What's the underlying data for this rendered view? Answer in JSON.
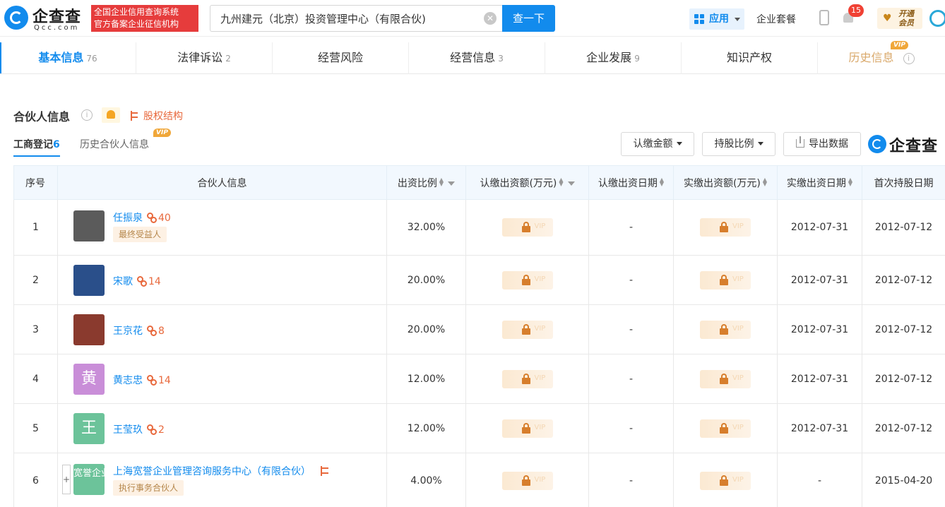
{
  "header": {
    "logo_cn": "企查查",
    "logo_en": "Qcc.com",
    "slogan_line1": "全国企业信用查询系统",
    "slogan_line2": "官方备案企业征信机构",
    "search_value": "九州建元（北京）投资管理中心（有限合伙)",
    "search_button": "查一下",
    "app_label": "应用",
    "package_label": "企业套餐",
    "notification_count": "15",
    "vip_line1": "开通",
    "vip_line2": "会员"
  },
  "tabs": [
    {
      "label": "基本信息",
      "count": "76",
      "active": true
    },
    {
      "label": "法律诉讼",
      "count": "2"
    },
    {
      "label": "经营风险",
      "count": ""
    },
    {
      "label": "经营信息",
      "count": "3"
    },
    {
      "label": "企业发展",
      "count": "9"
    },
    {
      "label": "知识产权",
      "count": ""
    },
    {
      "label": "历史信息",
      "count": "",
      "vip": "VIP"
    }
  ],
  "section": {
    "title": "合伙人信息",
    "equity_link": "股权结构",
    "subtab_registered": "工商登记",
    "subtab_registered_count": "6",
    "subtab_history": "历史合伙人信息",
    "vip_badge": "VIP",
    "btn_subscribed": "认缴金额",
    "btn_ratio": "持股比例",
    "btn_export": "导出数据",
    "brand_mark": "企查查"
  },
  "table": {
    "headers": [
      "序号",
      "合伙人信息",
      "出资比例",
      "认缴出资额(万元)",
      "认缴出资日期",
      "实缴出资额(万元)",
      "实缴出资日期",
      "首次持股日期"
    ],
    "rows": [
      {
        "no": "1",
        "name": "任振泉",
        "links": "40",
        "tag": "最终受益人",
        "avatar_text": "",
        "avatar_color": "#5b5b5b",
        "ratio": "32.00%",
        "sub_date": "-",
        "paid_date": "2012-07-31",
        "first_date": "2012-07-12"
      },
      {
        "no": "2",
        "name": "宋歌",
        "links": "14",
        "tag": "",
        "avatar_text": "",
        "avatar_color": "#2a4f8a",
        "ratio": "20.00%",
        "sub_date": "-",
        "paid_date": "2012-07-31",
        "first_date": "2012-07-12"
      },
      {
        "no": "3",
        "name": "王京花",
        "links": "8",
        "tag": "",
        "avatar_text": "",
        "avatar_color": "#8a3a2e",
        "ratio": "20.00%",
        "sub_date": "-",
        "paid_date": "2012-07-31",
        "first_date": "2012-07-12"
      },
      {
        "no": "4",
        "name": "黄志忠",
        "links": "14",
        "tag": "",
        "avatar_text": "黄",
        "avatar_color": "#c98ed8",
        "ratio": "12.00%",
        "sub_date": "-",
        "paid_date": "2012-07-31",
        "first_date": "2012-07-12"
      },
      {
        "no": "5",
        "name": "王莹玖",
        "links": "2",
        "tag": "",
        "avatar_text": "王",
        "avatar_color": "#6cc39a",
        "ratio": "12.00%",
        "sub_date": "-",
        "paid_date": "2012-07-31",
        "first_date": "2012-07-12"
      },
      {
        "no": "6",
        "name": "上海宽誉企业管理咨询服务中心（有限合伙）",
        "links": "",
        "tag": "执行事务合伙人",
        "avatar_text": "宽誉企业",
        "avatar_color": "#6cc39a",
        "ratio": "4.00%",
        "sub_date": "-",
        "paid_date": "-",
        "first_date": "2015-04-20",
        "expand": "+"
      }
    ]
  },
  "colors": {
    "accent": "#128bed",
    "link_orange": "#e8693d",
    "slogan_red": "#e63c3c"
  },
  "icons": [
    "search-clear-icon",
    "app-grid-icon",
    "phone-icon",
    "bell-icon",
    "info-icon",
    "equity-tree-icon",
    "export-icon",
    "lock-icon",
    "sort-icon",
    "filter-icon"
  ]
}
